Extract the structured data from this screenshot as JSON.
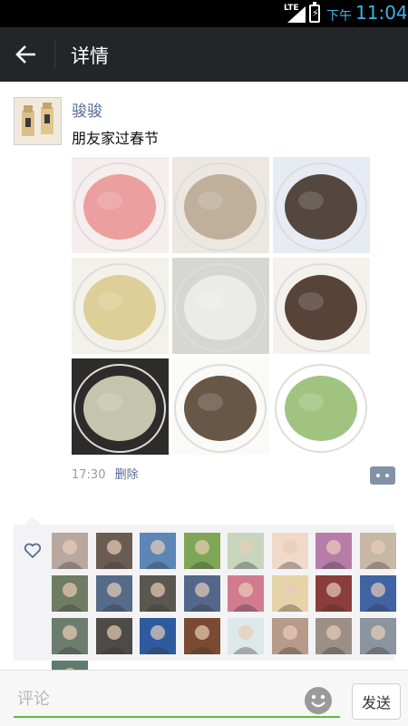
{
  "status_bar": {
    "network": "LTE",
    "ampm": "下午",
    "time": "11:04"
  },
  "nav": {
    "title": "详情"
  },
  "post": {
    "author": "骏骏",
    "text": "朋友家过春节",
    "time": "17:30",
    "delete_label": "删除",
    "photos": [
      {
        "name": "photo-sliced-ham",
        "colors": [
          "#f6eeee",
          "#e9908f"
        ]
      },
      {
        "name": "photo-braised-tripe",
        "colors": [
          "#ece7e1",
          "#b7a58e"
        ]
      },
      {
        "name": "photo-mushroom-dish",
        "colors": [
          "#e7ebf4",
          "#3a2a1e"
        ]
      },
      {
        "name": "photo-noodle-salad",
        "colors": [
          "#f3f1ea",
          "#d8c98a"
        ]
      },
      {
        "name": "photo-dumplings",
        "colors": [
          "#d6d7d3",
          "#eeeeea"
        ]
      },
      {
        "name": "photo-braised-beef",
        "colors": [
          "#f5f2ed",
          "#3b2517"
        ]
      },
      {
        "name": "photo-sliced-bamboo",
        "colors": [
          "#2e2c2a",
          "#dfe1c6"
        ]
      },
      {
        "name": "photo-sliced-meat",
        "colors": [
          "#fafaf8",
          "#4d3a28"
        ]
      },
      {
        "name": "photo-shrimp-broccoli",
        "colors": [
          "#ffffff",
          "#8fb86a"
        ]
      }
    ]
  },
  "likes": {
    "avatars": [
      {
        "name": "like-avatar-1",
        "color": "#b9a8a0"
      },
      {
        "name": "like-avatar-2",
        "color": "#6b5c52"
      },
      {
        "name": "like-avatar-3",
        "color": "#5b86b7"
      },
      {
        "name": "like-avatar-4",
        "color": "#7fa656"
      },
      {
        "name": "like-avatar-5",
        "color": "#c8d6bd"
      },
      {
        "name": "like-avatar-6",
        "color": "#f1d9c9"
      },
      {
        "name": "like-avatar-7",
        "color": "#b77ca7"
      },
      {
        "name": "like-avatar-8",
        "color": "#c6b7a6"
      },
      {
        "name": "like-avatar-9",
        "color": "#6f7b62"
      },
      {
        "name": "like-avatar-10",
        "color": "#556b88"
      },
      {
        "name": "like-avatar-11",
        "color": "#5a5650"
      },
      {
        "name": "like-avatar-12",
        "color": "#53678a"
      },
      {
        "name": "like-avatar-13",
        "color": "#d27a8f"
      },
      {
        "name": "like-avatar-14",
        "color": "#e6d4a8"
      },
      {
        "name": "like-avatar-15",
        "color": "#8a3d3a"
      },
      {
        "name": "like-avatar-16",
        "color": "#3f63a3"
      },
      {
        "name": "like-avatar-17",
        "color": "#6c7d70"
      },
      {
        "name": "like-avatar-18",
        "color": "#4e4a47"
      },
      {
        "name": "like-avatar-19",
        "color": "#2e5b9f"
      },
      {
        "name": "like-avatar-20",
        "color": "#7b4a33"
      },
      {
        "name": "like-avatar-21",
        "color": "#dde8ea"
      },
      {
        "name": "like-avatar-22",
        "color": "#b79a88"
      },
      {
        "name": "like-avatar-23",
        "color": "#9c8f86"
      },
      {
        "name": "like-avatar-24",
        "color": "#8b95a0"
      },
      {
        "name": "like-avatar-25",
        "color": "#5f7b6c"
      }
    ]
  },
  "input": {
    "placeholder": "评论",
    "send_label": "发送"
  },
  "colors": {
    "link": "#576b95",
    "accent_green": "#5cbd3c",
    "nav_bg": "#222629"
  }
}
